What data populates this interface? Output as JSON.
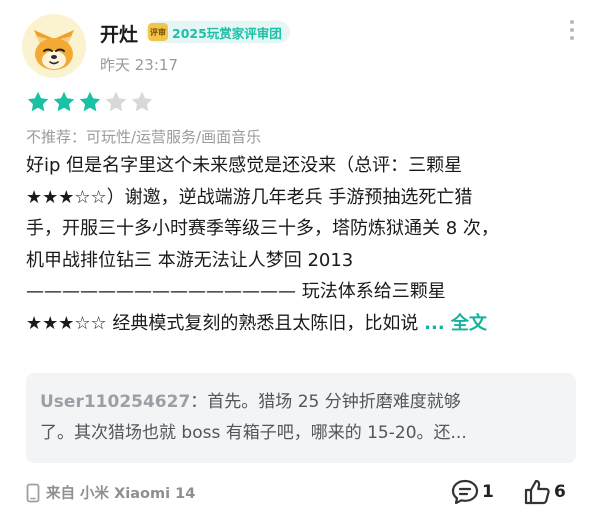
{
  "user": {
    "name": "开灶",
    "badge_seal": "评审",
    "badge": "2025玩赏家评审团",
    "time": "昨天 23:17"
  },
  "rating": {
    "value": 3,
    "max": 5,
    "filled_color": "#19c2a5",
    "empty_color": "#d8d8d8"
  },
  "tags": "不推荐：可玩性/运营服务/画面音乐",
  "review": {
    "lines": [
      "好ip 但是名字里这个未来感觉是还没来（总评：三颗星",
      "★★★☆☆）谢邀，逆战端游几年老兵 手游预抽选死亡猎",
      "手，开服三十多小时赛季等级三十多，塔防炼狱通关 8 次，",
      "机甲战排位钻三 本游无法让人梦回 2013",
      "——————————————— 玩法体系给三颗星"
    ],
    "last_line": "★★★☆☆ 经典模式复刻的熟悉且太陈旧，比如说 ",
    "more_label": "... 全文"
  },
  "reply": {
    "user": "User110254627",
    "separator": "：",
    "line1": "首先。猎场 25 分钟折磨难度就够",
    "line2": "了。其次猎场也就 boss 有箱子吧，哪来的 15-20。还..."
  },
  "footer": {
    "device": "来自 小米 Xiaomi 14",
    "comments": "1",
    "likes": "6"
  },
  "icons": {
    "avatar": "shiba-dog-avatar",
    "more": "more-vertical-icon",
    "star": "star-icon",
    "phone": "phone-icon",
    "comment": "comment-icon",
    "like": "thumbs-up-icon"
  }
}
